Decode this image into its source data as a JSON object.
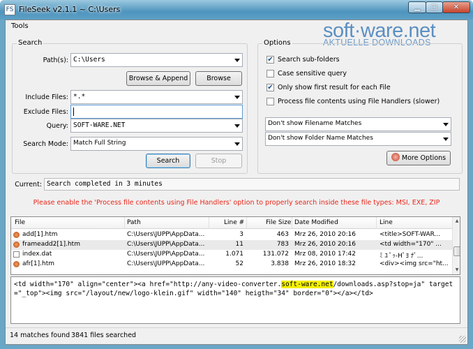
{
  "window": {
    "title": "FileSeek v2.1.1 ~ C:\\Users",
    "app_icon": "FS"
  },
  "titlebar_buttons": {
    "minimize": "▁",
    "maximize": "□",
    "close": "✕"
  },
  "menu": {
    "tools": "Tools"
  },
  "brand": {
    "main": "soft·ware.net",
    "sub": "AKTUELLE DOWNLOADS"
  },
  "search": {
    "group_title": "Search",
    "paths_label": "Path(s):",
    "paths_value": "C:\\Users",
    "browse_append": "Browse & Append",
    "browse": "Browse",
    "include_label": "Include Files:",
    "include_value": "*.*",
    "exclude_label": "Exclude Files:",
    "exclude_value": "",
    "query_label": "Query:",
    "query_value": "SOFT-WARE.NET",
    "mode_label": "Search Mode:",
    "mode_value": "Match Full String",
    "search_button": "Search",
    "stop_button": "Stop"
  },
  "options": {
    "group_title": "Options",
    "checks": [
      {
        "label": "Search sub-folders",
        "checked": true
      },
      {
        "label": "Case sensitive query",
        "checked": false
      },
      {
        "label": "Only show first result for each File",
        "checked": true
      },
      {
        "label": "Process file contents using File Handlers (slower)",
        "checked": false
      }
    ],
    "filename_matches": "Don't show Filename Matches",
    "folder_matches": "Don't show Folder Name Matches",
    "more_options": "More Options"
  },
  "current": {
    "label": "Current:",
    "value": "Search completed in 3 minutes"
  },
  "notice": "Please enable the 'Process file contents using File Handlers' option to properly search inside these file types: MSI, EXE, ZIP",
  "results": {
    "columns": [
      "File",
      "Path",
      "Line #",
      "File Size",
      "Date Modified",
      "Line"
    ],
    "rows": [
      {
        "file": "add[1].htm",
        "path": "C:\\Users\\JUPP\\AppData...",
        "line_no": "3",
        "size": "463",
        "date": "Mrz 26, 2010 20:16",
        "line": "<title>SOFT-WAR...",
        "icon": "htm-icon",
        "selected": false
      },
      {
        "file": "frameadd2[1].htm",
        "path": "C:\\Users\\JUPP\\AppData...",
        "line_no": "11",
        "size": "783",
        "date": "Mrz 26, 2010 20:16",
        "line": "<td width=\"170\" ...",
        "icon": "htm-icon",
        "selected": true
      },
      {
        "file": "index.dat",
        "path": "C:\\Users\\JUPP\\AppData...",
        "line_no": "1.071",
        "size": "131.072",
        "date": "Mrz 08, 2010 17:42",
        "line": "ﾐ ﾕ ﾟｯ-Hﾟﾖ ﾅﾟ...",
        "icon": "dat-icon",
        "selected": false
      },
      {
        "file": "afr[1].htm",
        "path": "C:\\Users\\JUPP\\AppData...",
        "line_no": "52",
        "size": "3.838",
        "date": "Mrz 26, 2010 18:32",
        "line": "<div><img src=\"ht...",
        "icon": "htm-icon",
        "selected": false
      }
    ]
  },
  "preview": {
    "before": "<td width=\"170\" align=\"center\"><a href=\"http://any-video-converter.",
    "highlight": "soft-ware.net",
    "after": "/downloads.asp?stop=ja\" target=\"_top\"><img src=\"/layout/new/logo-klein.gif\" width=\"140\" heigth=\"34\" border=\"0\"></a></td>"
  },
  "statusbar": {
    "matches": "14 matches found",
    "files": "3841 files searched"
  }
}
